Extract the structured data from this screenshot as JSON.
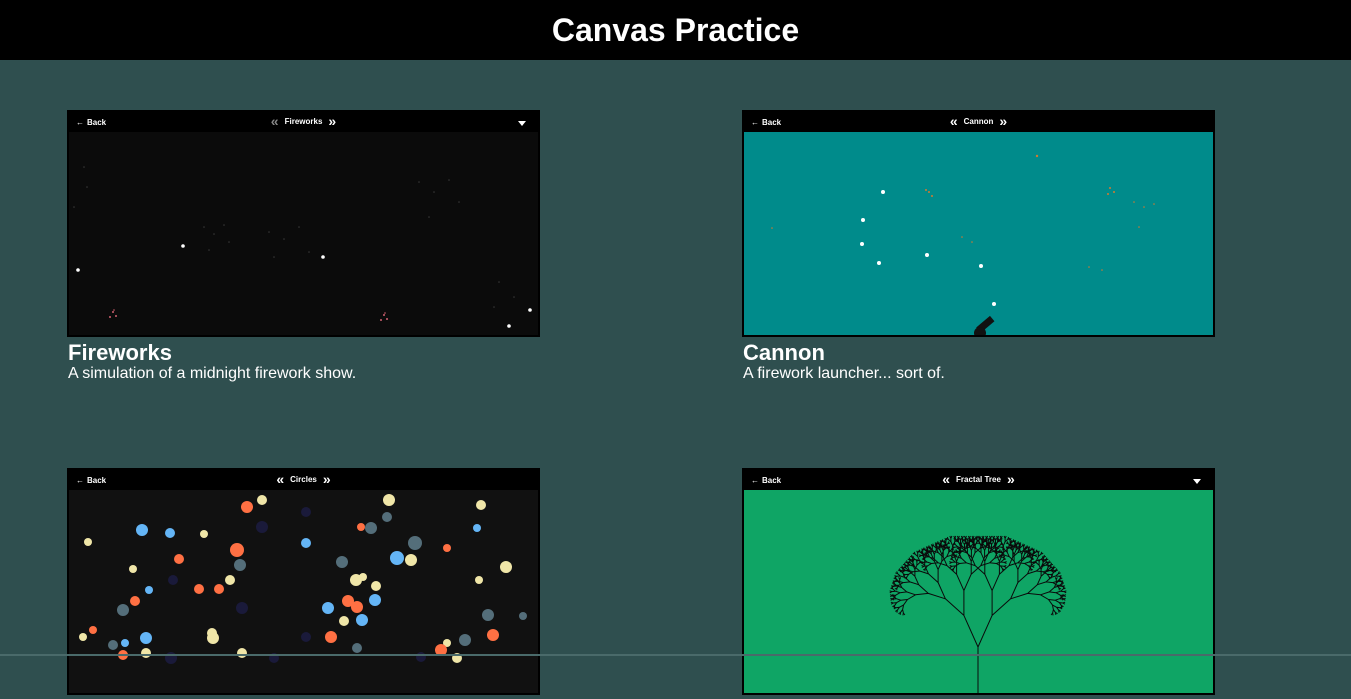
{
  "header": {
    "title": "Canvas Practice"
  },
  "demo_bar": {
    "back_label": "Back",
    "prev_icon": "double-chevron-left-icon",
    "next_icon": "double-chevron-right-icon",
    "menu_icon": "caret-down-icon"
  },
  "cards": [
    {
      "title": "Fireworks",
      "description": "A simulation of a midnight firework show.",
      "bar_label": "Fireworks",
      "background": "#0b0b0b",
      "has_menu": true
    },
    {
      "title": "Cannon",
      "description": "A firework launcher... sort of.",
      "bar_label": "Cannon",
      "background": "#008b8b",
      "has_menu": false
    },
    {
      "title": "",
      "description": "",
      "bar_label": "Circles",
      "background": "#111111",
      "has_menu": false
    },
    {
      "title": "",
      "description": "",
      "bar_label": "Fractal Tree",
      "background": "#0fa565",
      "has_menu": true
    }
  ],
  "colors": {
    "page_background": "#2f4f4f",
    "header_background": "#000000",
    "circle_palette": [
      "#ff7043",
      "#64b5f6",
      "#f0e6a8",
      "#546e7a",
      "#1a1a3a"
    ]
  }
}
